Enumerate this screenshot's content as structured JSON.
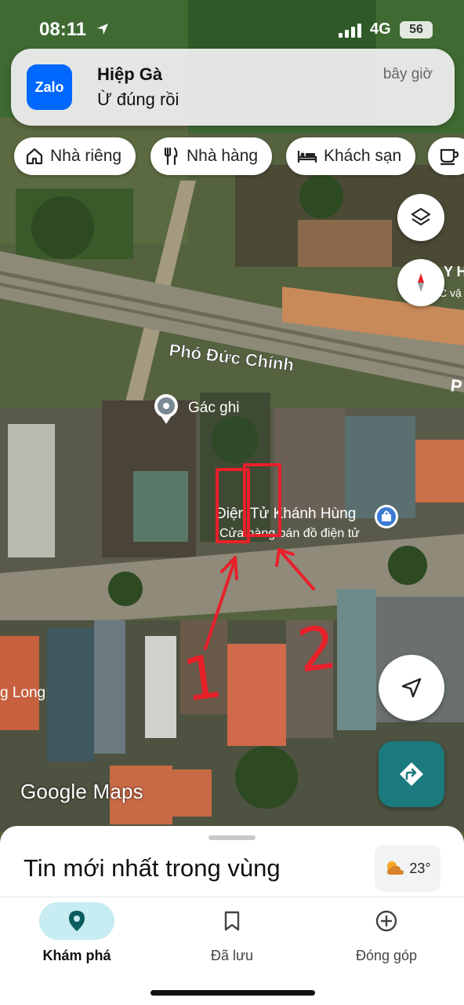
{
  "status_bar": {
    "time": "08:11",
    "network": "4G",
    "battery": "56"
  },
  "notification": {
    "app": "Zalo",
    "sender": "Hiệp Gà",
    "message": "Ừ đúng rồi",
    "time": "bây giờ"
  },
  "chips": [
    {
      "label": "Nhà riêng",
      "icon": "home-icon"
    },
    {
      "label": "Nhà hàng",
      "icon": "restaurant-icon"
    },
    {
      "label": "Khách sạn",
      "icon": "hotel-icon"
    },
    {
      "label": "",
      "icon": "coffee-icon"
    }
  ],
  "map": {
    "street_label": "Phó Đức Chính",
    "street_label_right": "P",
    "place_gac_ghi": "Gác ghi",
    "shop_name": "Điện Tử Khánh Hùng",
    "shop_category": "Cửa hàng bán đồ điện tử",
    "left_label": "g Long",
    "top_right_label": "Y HÀ",
    "top_right_sub": "C    vậ",
    "annotation_1": "1",
    "annotation_2": "2",
    "watermark": "Google Maps"
  },
  "sheet": {
    "title": "Tin mới nhất trong vùng",
    "temperature": "23°"
  },
  "nav": [
    {
      "label": "Khám phá",
      "icon": "explore-pin-icon",
      "active": true
    },
    {
      "label": "Đã lưu",
      "icon": "bookmark-icon",
      "active": false
    },
    {
      "label": "Đóng góp",
      "icon": "add-circle-icon",
      "active": false
    }
  ],
  "colors": {
    "accent_teal": "#1a7a7d",
    "nav_active_bg": "#c7ecf1",
    "annotation_red": "#e8202a",
    "zalo_blue": "#0068ff"
  }
}
